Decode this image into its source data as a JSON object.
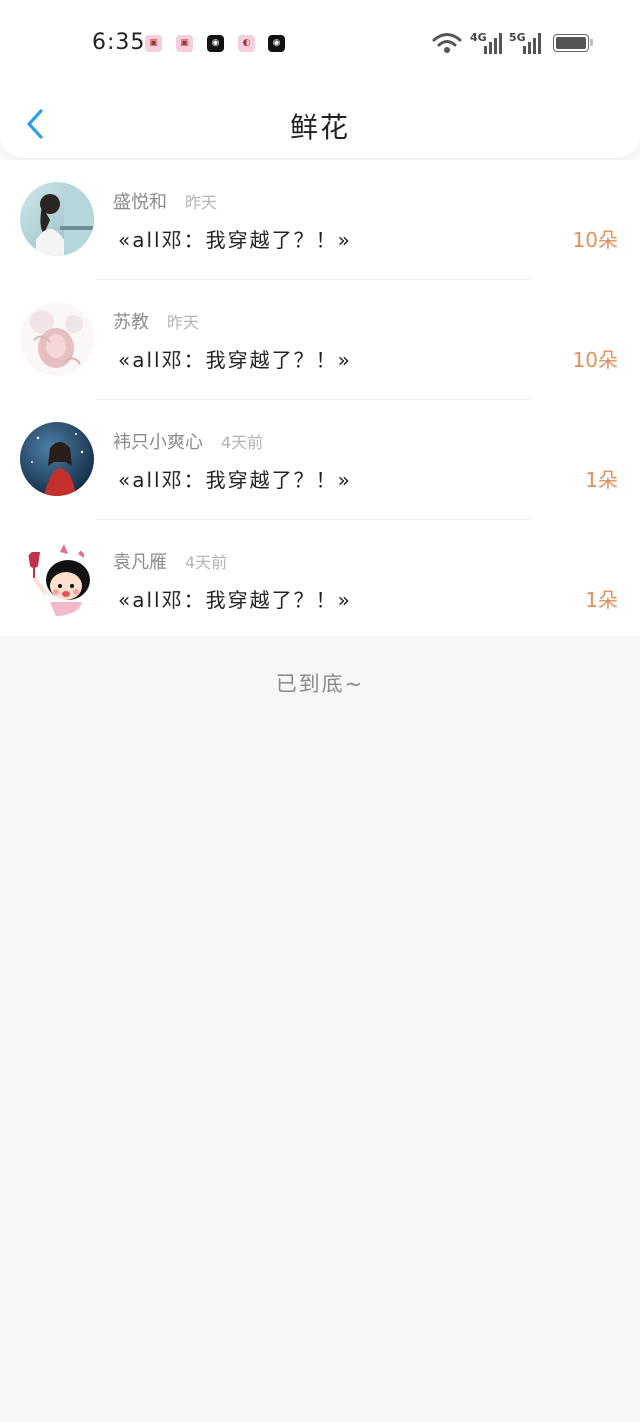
{
  "status_bar": {
    "time": "6:35",
    "notifications": [
      "pink-app-icon",
      "pink-app-icon",
      "weibo-icon",
      "messenger-icon",
      "weibo-icon"
    ],
    "network_1": "4G",
    "network_2": "5G"
  },
  "header": {
    "title": "鲜花"
  },
  "items": [
    {
      "name": "盛悦和",
      "time": "昨天",
      "book": "«all邓：我穿越了？！»",
      "count": "10朵"
    },
    {
      "name": "苏教",
      "time": "昨天",
      "book": "«all邓：我穿越了？！»",
      "count": "10朵"
    },
    {
      "name": "袆只小爽心",
      "time": "4天前",
      "book": "«all邓：我穿越了？！»",
      "count": "1朵"
    },
    {
      "name": "袁凡雁",
      "time": "4天前",
      "book": "«all邓：我穿越了？！»",
      "count": "1朵"
    }
  ],
  "footer": {
    "end_text": "已到底~"
  },
  "colors": {
    "accent_blue": "#2f9fe8",
    "count_orange": "#e0925a",
    "page_bg": "#f8f7f8"
  }
}
